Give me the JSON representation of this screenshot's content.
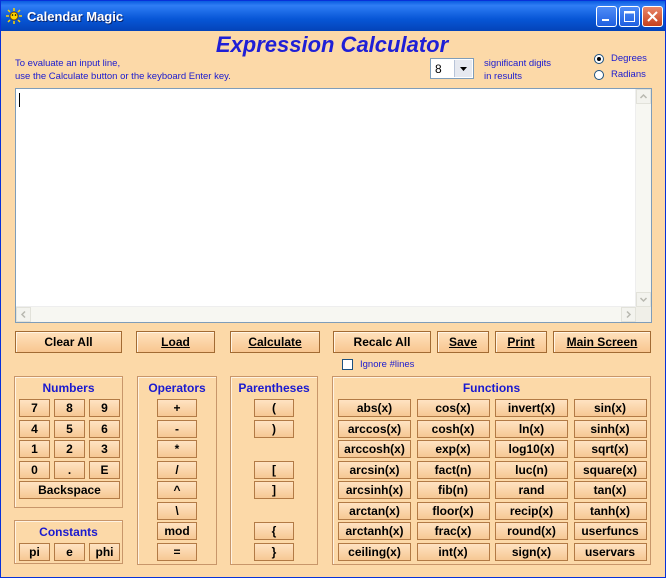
{
  "window": {
    "title": "Calendar Magic",
    "minimize_icon": "minimize-icon",
    "maximize_icon": "maximize-icon",
    "close_icon": "close-icon"
  },
  "header": {
    "heading": "Expression Calculator",
    "instruction_line1": "To evaluate an input line,",
    "instruction_line2": "use the Calculate button or the keyboard Enter key.",
    "digits_value": "8",
    "sigdigits_line1": "significant digits",
    "sigdigits_line2": "in results",
    "radio_degrees": "Degrees",
    "radio_radians": "Radians",
    "selected_unit": "Degrees"
  },
  "input": {
    "value": ""
  },
  "actions": {
    "clear_all": "Clear All",
    "load": "Load",
    "calculate": "Calculate",
    "recalc_all": "Recalc All",
    "save": "Save",
    "print": "Print",
    "main_screen": "Main Screen",
    "ignore_lines": "Ignore #lines"
  },
  "numbers": {
    "title": "Numbers",
    "keys": [
      "7",
      "8",
      "9",
      "4",
      "5",
      "6",
      "1",
      "2",
      "3",
      "0",
      ".",
      "E"
    ],
    "backspace": "Backspace"
  },
  "constants": {
    "title": "Constants",
    "keys": [
      "pi",
      "e",
      "phi"
    ]
  },
  "operators": {
    "title": "Operators",
    "keys": [
      "+",
      "-",
      "*",
      "/",
      "^",
      "\\",
      "mod",
      "="
    ]
  },
  "parentheses": {
    "title": "Parentheses",
    "keys": [
      "(",
      ")",
      "[",
      "]",
      "{",
      "}"
    ]
  },
  "functions": {
    "title": "Functions",
    "keys": [
      "abs(x)",
      "cos(x)",
      "invert(x)",
      "sin(x)",
      "arccos(x)",
      "cosh(x)",
      "ln(x)",
      "sinh(x)",
      "arccosh(x)",
      "exp(x)",
      "log10(x)",
      "sqrt(x)",
      "arcsin(x)",
      "fact(n)",
      "luc(n)",
      "square(x)",
      "arcsinh(x)",
      "fib(n)",
      "rand",
      "tan(x)",
      "arctan(x)",
      "floor(x)",
      "recip(x)",
      "tanh(x)",
      "arctanh(x)",
      "frac(x)",
      "round(x)",
      "userfuncs",
      "ceiling(x)",
      "int(x)",
      "sign(x)",
      "uservars"
    ]
  }
}
